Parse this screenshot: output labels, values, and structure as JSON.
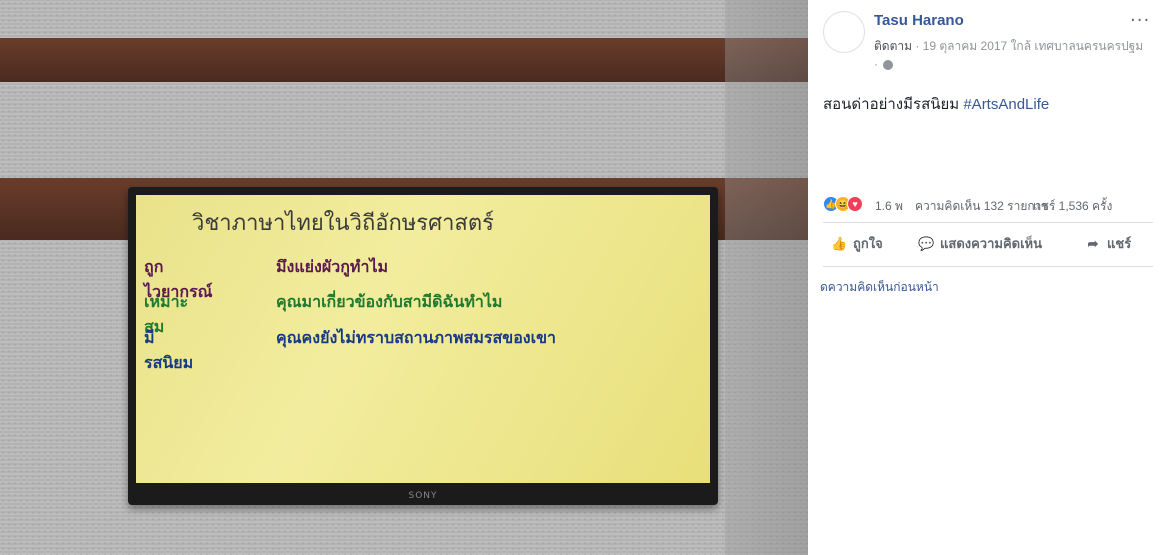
{
  "photo": {
    "screen_title": "วิชาภาษาไทยในวิถีอักษรศาสตร์",
    "rows": [
      {
        "label": "ถูกไวยากรณ์",
        "value": "มึงแย่งผัวกูทำไม"
      },
      {
        "label": "เหมาะสม",
        "value": "คุณมาเกี่ยวข้องกับสามีดิฉันทำไม"
      },
      {
        "label": "มีรสนิยม",
        "value": "คุณคงยังไม่ทราบสถานภาพสมรสของเขา"
      }
    ],
    "tv_brand": "SONY"
  },
  "post": {
    "author": "Tasu Harano",
    "follow": "ติดตาม",
    "meta_rest": " · 19 ตุลาคม 2017 ใกล้ เทศบาลนครนครปฐม ·",
    "text": "สอนด่าอย่างมีรสนิยม",
    "hashtag": "#ArtsAndLife",
    "reactions_count": "1.6 พ",
    "comments": "ความคิดเห็น 132 รายการ",
    "shares": "แชร์ 1,536 ครั้ง",
    "actions": {
      "like": "ถูกใจ",
      "comment": "แสดงความคิดเห็น",
      "share": "แชร์"
    },
    "previous_comments": "ดความคิดเห็นก่อนหน้า"
  },
  "icons": [
    "more-icon",
    "globe-icon",
    "like-reaction-icon",
    "haha-reaction-icon",
    "love-reaction-icon",
    "thumbs-up-icon",
    "comment-icon",
    "share-icon"
  ],
  "colors": {
    "link": "#365899",
    "muted": "#90949c",
    "screen_bg": "#f2ed9e",
    "row1": "#5a1a4f",
    "row2": "#1e7a2e",
    "row3": "#173a86"
  }
}
